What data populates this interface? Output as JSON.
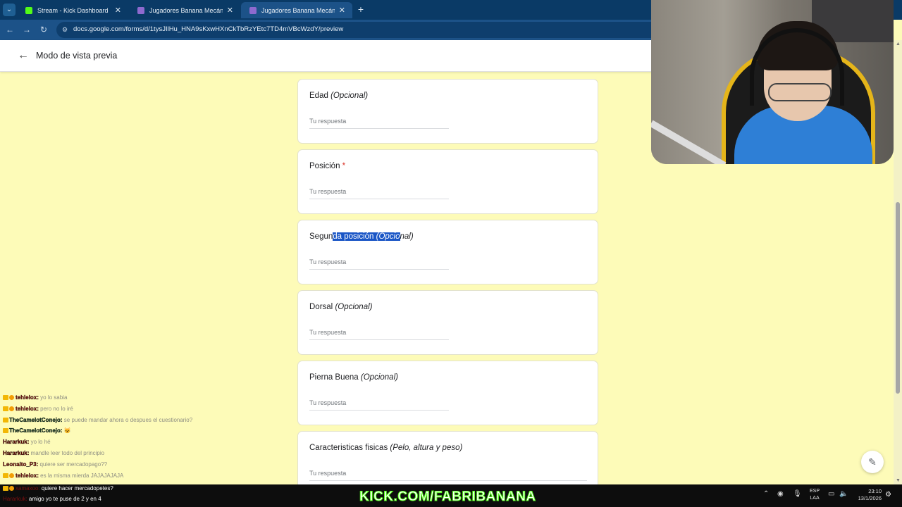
{
  "browser": {
    "tabs": [
      {
        "label": "Stream - Kick Dashboard",
        "active": false,
        "favicon": "kick-icon"
      },
      {
        "label": "Jugadores Banana Mecánica - I",
        "active": false,
        "favicon": "forms-icon"
      },
      {
        "label": "Jugadores Banana Mecánica",
        "active": true,
        "favicon": "forms-icon"
      }
    ],
    "url": "docs.google.com/forms/d/1tysJIlHu_HNA9sKxwHXnCkTbRzYEtc7TD4mVBcWzdY/preview"
  },
  "form_header": {
    "title": "Modo de vista previa"
  },
  "form": {
    "answer_placeholder": "Tu respuesta",
    "questions": [
      {
        "label": "Edad",
        "optional": "(Opcional)",
        "required": false
      },
      {
        "label": "Posición",
        "required": true,
        "required_mark": "*"
      },
      {
        "label_plain": "Segun",
        "label_selected": "da posición ",
        "optional_selected": "(Opcio",
        "optional_rest": "nal)",
        "required": false
      },
      {
        "label": "Dorsal",
        "optional": "(Opcional)",
        "required": false
      },
      {
        "label": "Pierna Buena",
        "optional": "(Opcional)",
        "required": false
      },
      {
        "label": "Caracteristicas fisicas",
        "optional": "(Pelo, altura y peso)",
        "required": false
      }
    ]
  },
  "chat": {
    "messages": [
      {
        "user": "tehlelox:",
        "text": "yo lo sabia"
      },
      {
        "user": "tehlelox:",
        "text": "pero no lo iré"
      },
      {
        "user": "TheCamelotConejo:",
        "text": "se puede mandar ahora o despues el cuestionario?"
      },
      {
        "user": "TheCamelotConejo:",
        "text": "😺"
      },
      {
        "user": "Hararkuk:",
        "text": "yo lo hé"
      },
      {
        "user": "Hararkuk:",
        "text": "mandle leer todo del principio"
      },
      {
        "user": "Leonaito_P3:",
        "text": "quiere ser mercadopago??"
      },
      {
        "user": "tehlelox:",
        "text": "es la misma mierda JAJAJAJAJA"
      }
    ],
    "bottom_messages": [
      {
        "user": "xamaxoo:",
        "text": "quiere hacer mercadopetes?"
      },
      {
        "user": "Hararkuk:",
        "text": "amigo yo te puse de 2 y en 4"
      }
    ]
  },
  "stream_banner": "KICK.COM/FABRIBANANA",
  "taskbar": {
    "lang_top": "ESP",
    "lang_bottom": "LAA",
    "time": "23:10",
    "date": "13/1/2026"
  },
  "colors": {
    "page_background": "#fdfbb8",
    "tab_strip": "#0a3a66",
    "selection": "#1a56c6",
    "required": "#d93025",
    "kick_green": "#53fc18"
  }
}
